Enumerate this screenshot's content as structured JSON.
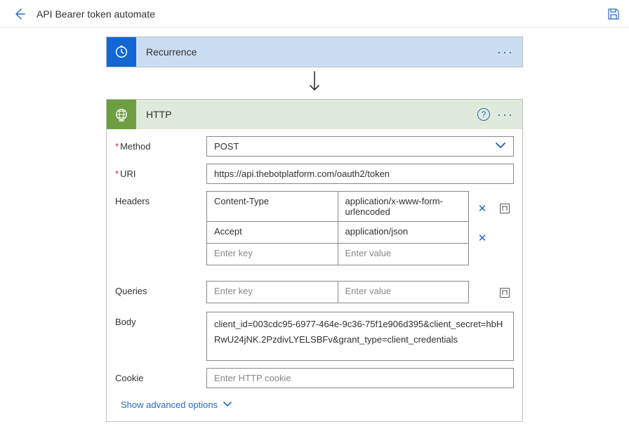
{
  "header": {
    "title": "API Bearer token automate"
  },
  "recurrence": {
    "title": "Recurrence"
  },
  "http": {
    "title": "HTTP",
    "labels": {
      "method": "Method",
      "uri": "URI",
      "headers": "Headers",
      "queries": "Queries",
      "body": "Body",
      "cookie": "Cookie"
    },
    "method_value": "POST",
    "uri_value": "https://api.thebotplatform.com/oauth2/token",
    "headers": [
      {
        "key": "Content-Type",
        "value": "application/x-www-form-urlencoded"
      },
      {
        "key": "Accept",
        "value": "application/json"
      }
    ],
    "header_placeholder_key": "Enter key",
    "header_placeholder_value": "Enter value",
    "query_placeholder_key": "Enter key",
    "query_placeholder_value": "Enter value",
    "body_value": "client_id=003cdc95-6977-464e-9c36-75f1e906d395&client_secret=hbHRwU24jNK.2PzdivLYELSBFv&grant_type=client_credentials",
    "cookie_placeholder": "Enter HTTP cookie",
    "advanced_link": "Show advanced options"
  }
}
